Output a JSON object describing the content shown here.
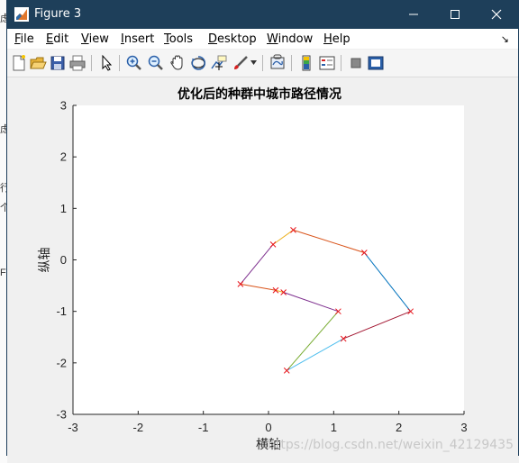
{
  "window": {
    "title": "Figure 3"
  },
  "background_fragments": [
    "虑",
    "虑",
    "行",
    "个",
    "Fil"
  ],
  "menu": {
    "items": [
      {
        "pre": "",
        "u": "F",
        "post": "ile"
      },
      {
        "pre": "",
        "u": "E",
        "post": "dit"
      },
      {
        "pre": "",
        "u": "V",
        "post": "iew"
      },
      {
        "pre": "",
        "u": "I",
        "post": "nsert"
      },
      {
        "pre": "",
        "u": "T",
        "post": "ools"
      },
      {
        "pre": "",
        "u": "D",
        "post": "esktop"
      },
      {
        "pre": "",
        "u": "W",
        "post": "indow"
      },
      {
        "pre": "",
        "u": "H",
        "post": "elp"
      }
    ],
    "overflow_icon": "double-arrow-icon"
  },
  "toolbar": {
    "icons": [
      "new-figure-icon",
      "open-file-icon",
      "save-icon",
      "print-icon",
      "edit-plot-arrow-icon",
      "zoom-in-icon",
      "zoom-out-icon",
      "pan-hand-icon",
      "rotate-3d-icon",
      "data-cursor-icon",
      "brush-icon",
      "brush-dropdown-icon",
      "link-plot-icon",
      "colorbar-icon",
      "legend-icon",
      "hide-plot-tools-icon",
      "show-plot-tools-icon"
    ]
  },
  "chart_data": {
    "type": "line",
    "title": "优化后的种群中城市路径情况",
    "xlabel": "横轴",
    "ylabel": "纵轴",
    "xlim": [
      -3,
      3
    ],
    "ylim": [
      -3,
      3
    ],
    "xticks": [
      "-3",
      "-2",
      "-1",
      "0",
      "1",
      "2",
      "3"
    ],
    "yticks": [
      "-3",
      "-2",
      "-1",
      "0",
      "1",
      "2",
      "3"
    ],
    "grid": false,
    "marker": "x",
    "marker_color": "#e8141b",
    "segments": [
      {
        "from": [
          0.38,
          0.58
        ],
        "to": [
          1.47,
          0.14
        ],
        "color": "#d95319"
      },
      {
        "from": [
          1.47,
          0.14
        ],
        "to": [
          2.18,
          -1.0
        ],
        "color": "#0072bd"
      },
      {
        "from": [
          2.18,
          -1.0
        ],
        "to": [
          1.15,
          -1.53
        ],
        "color": "#a2142f"
      },
      {
        "from": [
          1.15,
          -1.53
        ],
        "to": [
          0.28,
          -2.15
        ],
        "color": "#4dbeee"
      },
      {
        "from": [
          0.28,
          -2.15
        ],
        "to": [
          1.07,
          -1.0
        ],
        "color": "#77ac30"
      },
      {
        "from": [
          1.07,
          -1.0
        ],
        "to": [
          0.23,
          -0.63
        ],
        "color": "#7e2f8e"
      },
      {
        "from": [
          0.23,
          -0.63
        ],
        "to": [
          0.11,
          -0.59
        ],
        "color": "#edb120"
      },
      {
        "from": [
          0.11,
          -0.59
        ],
        "to": [
          -0.43,
          -0.47
        ],
        "color": "#d95319"
      },
      {
        "from": [
          -0.43,
          -0.47
        ],
        "to": [
          0.07,
          0.3
        ],
        "color": "#7e2f8e"
      },
      {
        "from": [
          0.07,
          0.3
        ],
        "to": [
          0.38,
          0.58
        ],
        "color": "#edb120"
      }
    ],
    "points": [
      [
        0.38,
        0.58
      ],
      [
        1.47,
        0.14
      ],
      [
        2.18,
        -1.0
      ],
      [
        1.15,
        -1.53
      ],
      [
        0.28,
        -2.15
      ],
      [
        1.07,
        -1.0
      ],
      [
        0.23,
        -0.63
      ],
      [
        0.11,
        -0.59
      ],
      [
        -0.43,
        -0.47
      ],
      [
        0.07,
        0.3
      ]
    ]
  },
  "watermark": "https://blog.csdn.net/weixin_42129435"
}
